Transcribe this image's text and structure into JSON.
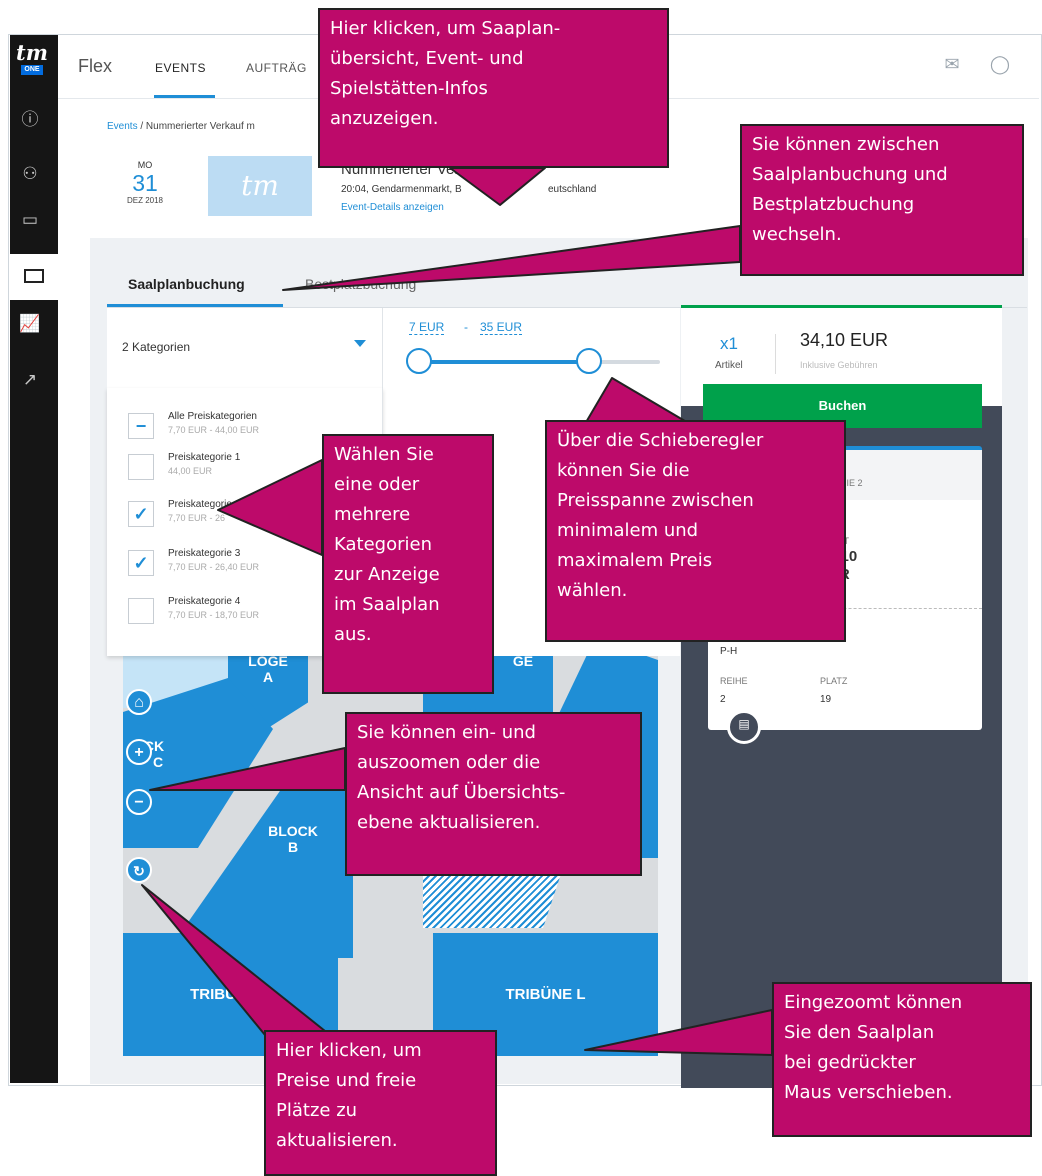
{
  "app": {
    "brand": "Flex",
    "logo": "tm",
    "logo_sub": "ONE"
  },
  "nav": {
    "events": "EVENTS",
    "orders": "AUFTRÄG"
  },
  "breadcrumb": {
    "link": "Events",
    "rest": " / Nummerierter Verkauf m"
  },
  "event": {
    "dow": "MO",
    "day": "31",
    "month_year": "DEZ 2018",
    "image_text": "tm",
    "title": "Nummerierter Verkau",
    "subtitle": "20:04, Gendarmenmarkt, B",
    "subtitle_end": "eutschland",
    "details_link": "Event-Details anzeigen"
  },
  "tabs": {
    "seatmap": "Saalplanbuchung",
    "best": "Bestplatzbuchung"
  },
  "filter": {
    "selected": "2 Kategorien"
  },
  "price_range": {
    "min_label": "7 EUR",
    "max_label": "35 EUR",
    "min_fraction": 0.05,
    "max_fraction": 0.72
  },
  "categories": [
    {
      "name": "Alle Preiskategorien",
      "range": "7,70 EUR - 44,00 EUR",
      "state": "partial"
    },
    {
      "name": "Preiskategorie 1",
      "range": "44,00 EUR",
      "state": "off"
    },
    {
      "name": "Preiskategorie 2",
      "range": "7,70 EUR - 26",
      "state": "on"
    },
    {
      "name": "Preiskategorie 3",
      "range": "7,70 EUR - 26,40 EUR",
      "state": "on"
    },
    {
      "name": "Preiskategorie 4",
      "range": "7,70 EUR - 18,70 EUR",
      "state": "off"
    }
  ],
  "map": {
    "loge_a_1": "LOGE",
    "loge_a_2": "A",
    "block_c_1": "OCK",
    "block_c_2": "C",
    "block_b_1": "BLOCK",
    "block_b_2": "B",
    "loge_right": "GE",
    "tribune_e": "TRIBÜNE E",
    "tribune_l": "TRIBÜNE L"
  },
  "cart": {
    "qty": "x1",
    "qty_label": "Artikel",
    "total": "34,10 EUR",
    "fees": "Inklusive Gebühren",
    "buy": "Buchen",
    "category": "GORIE 2",
    "sum_label": "AMT",
    "sum_1": "4,10",
    "sum_2": "UR",
    "block": "P-H",
    "row_label": "REIHE",
    "row": "2",
    "seat_label": "PLATZ",
    "seat": "19"
  },
  "annotations": {
    "a1": [
      "Hier klicken, um Saaplan-",
      "übersicht, Event- und",
      "Spielstätten-Infos",
      "anzuzeigen."
    ],
    "a2": [
      "Sie können zwischen",
      "Saalplanbuchung und",
      "Bestplatzbuchung",
      "wechseln."
    ],
    "a3": [
      "Wählen Sie",
      "eine oder",
      "mehrere",
      "Kategorien",
      "zur Anzeige",
      "im Saalplan",
      "aus."
    ],
    "a4": [
      "Über die Schieberegler",
      "können Sie die",
      "Preisspanne zwischen",
      "minimalem und",
      "maximalem Preis",
      "wählen."
    ],
    "a5": [
      "Sie können ein- und",
      "auszoomen oder die",
      "Ansicht auf Übersichts-",
      "ebene aktualisieren."
    ],
    "a6": [
      "Hier klicken, um",
      "Preise und freie",
      "Plätze zu",
      "aktualisieren."
    ],
    "a7": [
      "Eingezoomt können",
      "Sie den Saalplan",
      "bei gedrückter",
      "Maus verschieben."
    ]
  },
  "colors": {
    "accent": "#1f8ed6",
    "buy": "#00a14b",
    "annotation": "#bd0a6a",
    "cart_bg": "#424a59"
  },
  "icons": {
    "home": "home-icon",
    "zoom_in": "plus-icon",
    "zoom_out": "minus-icon",
    "refresh": "refresh-icon",
    "chat": "chat-icon",
    "user": "user-icon"
  }
}
